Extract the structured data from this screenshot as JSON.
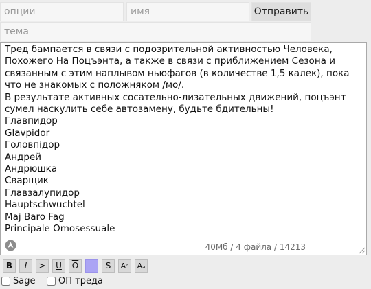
{
  "form": {
    "options_placeholder": "опции",
    "name_placeholder": "имя",
    "subject_placeholder": "тема",
    "submit_label": "Отправить"
  },
  "message": {
    "text": "Тред бампается в связи с подозрительной активностью Человека, Похожего На Поцъэнта, а также в связи с приближением Сезона и связанным с этим наплывом ньюфагов (в количестве 1,5 калек), пока что не знакомых с положняком /мо/.\nВ результате активных сосательно-лизательных движений, поцъэнт сумел наскулить себе автозамену, будьте бдительны!\nГлавпидор\nGlavpidor\nГоловпідор\nАндрей\nАндрюшка\nСварщик\nГлавзалупидор\nHauptschwuchtel\nMaj Baro Fag\nPrincipale Omosessuale",
    "counter": "40Мб / 4 файла / 14213"
  },
  "toolbar": {
    "buttons": [
      {
        "name": "bold-button",
        "label": "B"
      },
      {
        "name": "italic-button",
        "label": "I"
      },
      {
        "name": "quote-button",
        "label": ">"
      },
      {
        "name": "underline-button",
        "label": "U"
      },
      {
        "name": "overline-button",
        "label": "O"
      },
      {
        "name": "spoiler-button",
        "label": ""
      },
      {
        "name": "strike-button",
        "label": "S"
      },
      {
        "name": "superscript-button",
        "label": "Aᵃ"
      },
      {
        "name": "subscript-button",
        "label": "Aₐ"
      }
    ],
    "spoiler_color": "#aba4f4"
  },
  "options": {
    "sage_label": "Sage",
    "op_label": "ОП треда"
  }
}
